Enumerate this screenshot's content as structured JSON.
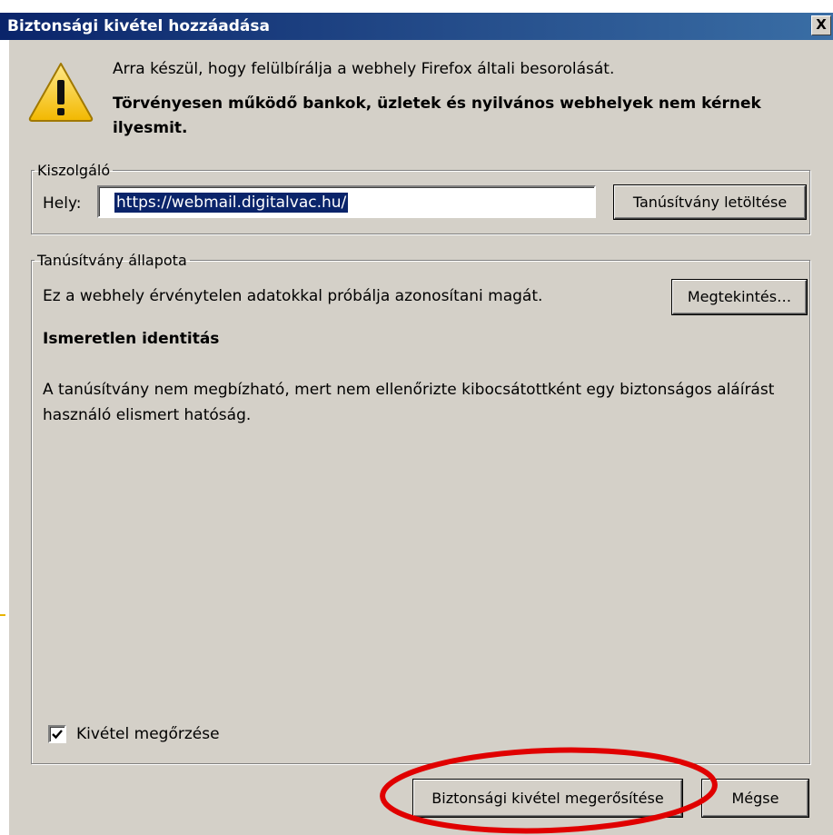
{
  "dialog": {
    "title": "Biztonsági kivétel hozzáadása",
    "close_label": "X"
  },
  "warning": {
    "message": "Arra készül, hogy felülbírálja a webhely Firefox általi besorolását.",
    "bold_message": "Törvényesen működő bankok, üzletek és nyilvános webhelyek nem kérnek ilyesmit."
  },
  "server_group": {
    "legend": "Kiszolgáló",
    "location_label": "Hely:",
    "location_value": "https://webmail.digitalvac.hu/",
    "get_certificate_button": "Tanúsítvány letöltése"
  },
  "certificate_status": {
    "legend": "Tanúsítvány állapota",
    "status_text": "Ez a webhely érvénytelen adatokkal próbálja azonosítani magát.",
    "view_button": "Megtekintés…",
    "identity_heading": "Ismeretlen identitás",
    "explanation": "A tanúsítvány nem megbízható, mert nem ellenőrizte kibocsátottként egy biztonságos aláírást használó elismert hatóság."
  },
  "permanent_checkbox": {
    "label": "Kivétel megőrzése",
    "checked": true
  },
  "buttons": {
    "confirm": "Biztonsági kivétel megerősítése",
    "cancel": "Mégse"
  },
  "colors": {
    "title_bar_start": "#0a246a",
    "title_bar_end": "#3a6ea5",
    "dialog_background": "#d4d0c8",
    "highlight_ellipse": "#e00000",
    "selection": "#0a246a"
  }
}
